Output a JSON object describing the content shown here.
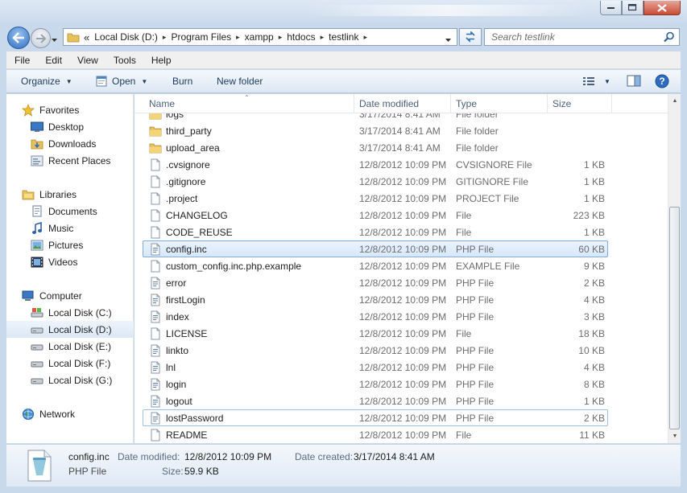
{
  "address": {
    "overflow": "«",
    "crumbs": [
      "Local Disk (D:)",
      "Program Files",
      "xampp",
      "htdocs",
      "testlink"
    ]
  },
  "search": {
    "placeholder": "Search testlink"
  },
  "menu": [
    "File",
    "Edit",
    "View",
    "Tools",
    "Help"
  ],
  "toolbar": {
    "organize": "Organize",
    "open": "Open",
    "burn": "Burn",
    "new_folder": "New folder"
  },
  "sidebar": {
    "favorites": {
      "label": "Favorites",
      "items": [
        {
          "label": "Desktop",
          "icon": "desktop-icon"
        },
        {
          "label": "Downloads",
          "icon": "downloads-folder-icon"
        },
        {
          "label": "Recent Places",
          "icon": "recent-places-icon"
        }
      ]
    },
    "libraries": {
      "label": "Libraries",
      "items": [
        {
          "label": "Documents",
          "icon": "documents-icon"
        },
        {
          "label": "Music",
          "icon": "music-icon"
        },
        {
          "label": "Pictures",
          "icon": "pictures-icon"
        },
        {
          "label": "Videos",
          "icon": "videos-icon"
        }
      ]
    },
    "computer": {
      "label": "Computer",
      "items": [
        {
          "label": "Local Disk (C:)",
          "icon": "system-drive-icon"
        },
        {
          "label": "Local Disk (D:)",
          "icon": "drive-icon",
          "selected": true
        },
        {
          "label": "Local Disk (E:)",
          "icon": "drive-icon"
        },
        {
          "label": "Local Disk (F:)",
          "icon": "drive-icon"
        },
        {
          "label": "Local Disk (G:)",
          "icon": "drive-icon"
        }
      ]
    },
    "network": {
      "label": "Network"
    }
  },
  "columns": {
    "name": "Name",
    "date": "Date modified",
    "type": "Type",
    "size": "Size"
  },
  "files": [
    {
      "name": "logs",
      "date": "3/17/2014 8:41 AM",
      "type": "File folder",
      "size": "",
      "icon": "folder-icon"
    },
    {
      "name": "third_party",
      "date": "3/17/2014 8:41 AM",
      "type": "File folder",
      "size": "",
      "icon": "folder-icon"
    },
    {
      "name": "upload_area",
      "date": "3/17/2014 8:41 AM",
      "type": "File folder",
      "size": "",
      "icon": "folder-icon"
    },
    {
      "name": ".cvsignore",
      "date": "12/8/2012 10:09 PM",
      "type": "CVSIGNORE File",
      "size": "1 KB",
      "icon": "file-icon"
    },
    {
      "name": ".gitignore",
      "date": "12/8/2012 10:09 PM",
      "type": "GITIGNORE File",
      "size": "1 KB",
      "icon": "file-icon"
    },
    {
      "name": ".project",
      "date": "12/8/2012 10:09 PM",
      "type": "PROJECT File",
      "size": "1 KB",
      "icon": "file-icon"
    },
    {
      "name": "CHANGELOG",
      "date": "12/8/2012 10:09 PM",
      "type": "File",
      "size": "223 KB",
      "icon": "file-icon"
    },
    {
      "name": "CODE_REUSE",
      "date": "12/8/2012 10:09 PM",
      "type": "File",
      "size": "1 KB",
      "icon": "file-icon"
    },
    {
      "name": "config.inc",
      "date": "12/8/2012 10:09 PM",
      "type": "PHP File",
      "size": "60 KB",
      "icon": "php-file-icon",
      "selected": true
    },
    {
      "name": "custom_config.inc.php.example",
      "date": "12/8/2012 10:09 PM",
      "type": "EXAMPLE File",
      "size": "9 KB",
      "icon": "file-icon"
    },
    {
      "name": "error",
      "date": "12/8/2012 10:09 PM",
      "type": "PHP File",
      "size": "2 KB",
      "icon": "php-file-icon"
    },
    {
      "name": "firstLogin",
      "date": "12/8/2012 10:09 PM",
      "type": "PHP File",
      "size": "4 KB",
      "icon": "php-file-icon"
    },
    {
      "name": "index",
      "date": "12/8/2012 10:09 PM",
      "type": "PHP File",
      "size": "3 KB",
      "icon": "php-file-icon"
    },
    {
      "name": "LICENSE",
      "date": "12/8/2012 10:09 PM",
      "type": "File",
      "size": "18 KB",
      "icon": "file-icon"
    },
    {
      "name": "linkto",
      "date": "12/8/2012 10:09 PM",
      "type": "PHP File",
      "size": "10 KB",
      "icon": "php-file-icon"
    },
    {
      "name": "lnl",
      "date": "12/8/2012 10:09 PM",
      "type": "PHP File",
      "size": "4 KB",
      "icon": "php-file-icon"
    },
    {
      "name": "login",
      "date": "12/8/2012 10:09 PM",
      "type": "PHP File",
      "size": "8 KB",
      "icon": "php-file-icon"
    },
    {
      "name": "logout",
      "date": "12/8/2012 10:09 PM",
      "type": "PHP File",
      "size": "1 KB",
      "icon": "php-file-icon"
    },
    {
      "name": "lostPassword",
      "date": "12/8/2012 10:09 PM",
      "type": "PHP File",
      "size": "2 KB",
      "icon": "php-file-icon",
      "focused": true
    },
    {
      "name": "README",
      "date": "12/8/2012 10:09 PM",
      "type": "File",
      "size": "11 KB",
      "icon": "file-icon"
    }
  ],
  "details": {
    "name": "config.inc",
    "type": "PHP File",
    "modified_label": "Date modified:",
    "modified": "12/8/2012 10:09 PM",
    "created_label": "Date created:",
    "created": "3/17/2014 8:41 AM",
    "size_label": "Size:",
    "size": "59.9 KB"
  }
}
